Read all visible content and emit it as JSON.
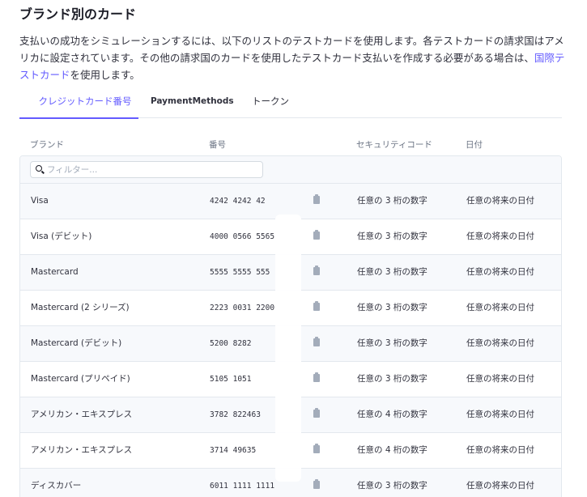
{
  "title": "ブランド別のカード",
  "description": {
    "text": "支払いの成功をシミュレーションするには、以下のリストのテストカードを使用します。各テストカードの請求国はアメリカに設定されています。その他の請求国のカードを使用したテストカード支払いを作成する必要がある場合は、",
    "link": "国際テストカード",
    "suffix": "を使用します。"
  },
  "tabs": [
    {
      "label": "クレジットカード番号",
      "active": true
    },
    {
      "label": "PaymentMethods",
      "active": false
    },
    {
      "label": "トークン",
      "active": false
    }
  ],
  "columns": {
    "brand": "ブランド",
    "number": "番号",
    "cvc": "セキュリティコード",
    "date": "日付"
  },
  "filter": {
    "placeholder": "フィルター..."
  },
  "rows": [
    {
      "brand": "Visa",
      "number": "4242 4242 42",
      "cvc": "任意の 3 桁の数字",
      "date": "任意の将来の日付"
    },
    {
      "brand": "Visa (デビット)",
      "number": "4000 0566 5565",
      "cvc": "任意の 3 桁の数字",
      "date": "任意の将来の日付"
    },
    {
      "brand": "Mastercard",
      "number": "5555 5555 555",
      "cvc": "任意の 3 桁の数字",
      "date": "任意の将来の日付"
    },
    {
      "brand": "Mastercard (2 シリーズ)",
      "number": "2223 0031 2200",
      "cvc": "任意の 3 桁の数字",
      "date": "任意の将来の日付"
    },
    {
      "brand": "Mastercard (デビット)",
      "number": "5200 8282",
      "cvc": "任意の 3 桁の数字",
      "date": "任意の将来の日付"
    },
    {
      "brand": "Mastercard (プリペイド)",
      "number": "5105 1051",
      "cvc": "任意の 3 桁の数字",
      "date": "任意の将来の日付"
    },
    {
      "brand": "アメリカン・エキスプレス",
      "number": "3782 822463",
      "cvc": "任意の 4 桁の数字",
      "date": "任意の将来の日付"
    },
    {
      "brand": "アメリカン・エキスプレス",
      "number": "3714 49635",
      "cvc": "任意の 4 桁の数字",
      "date": "任意の将来の日付"
    },
    {
      "brand": "ディスカバー",
      "number": "6011 1111 1111",
      "cvc": "任意の 3 桁の数字",
      "date": "任意の将来の日付"
    }
  ],
  "colors": {
    "accent": "#635bff",
    "border": "#e3e8ee",
    "stripe": "#f7f9fc"
  }
}
